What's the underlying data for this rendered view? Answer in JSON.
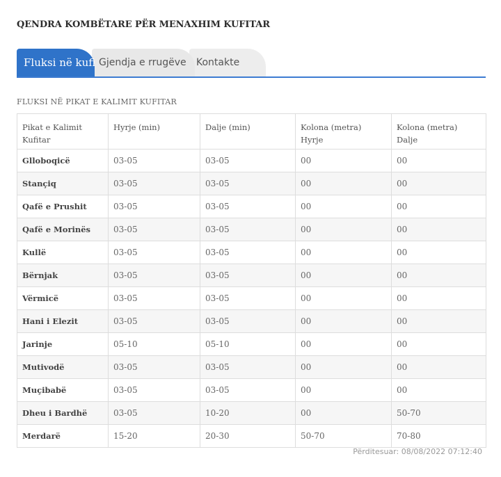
{
  "site": {
    "title": "QENDRA KOMBËTARE PËR MENAXHIM KUFITAR"
  },
  "tabs": [
    {
      "label": "Fluksi në kufi",
      "active": true
    },
    {
      "label": "Gjendja e rrugëve",
      "active": false
    },
    {
      "label": "Kontakte",
      "active": false
    }
  ],
  "section": {
    "title": "FLUKSI NË PIKAT E KALIMIT KUFITAR"
  },
  "table": {
    "headers": [
      "Pikat e Kalimit\nKufitar",
      "Hyrje (min)",
      "Dalje (min)",
      "Kolona (metra)\nHyrje",
      "Kolona (metra)\nDalje"
    ],
    "rows": [
      [
        "Glloboqicë",
        "03-05",
        "03-05",
        "00",
        "00"
      ],
      [
        "Stançiq",
        "03-05",
        "03-05",
        "00",
        "00"
      ],
      [
        "Qafë e Prushit",
        "03-05",
        "03-05",
        "00",
        "00"
      ],
      [
        "Qafë e Morinës",
        "03-05",
        "03-05",
        "00",
        "00"
      ],
      [
        "Kullë",
        "03-05",
        "03-05",
        "00",
        "00"
      ],
      [
        "Bërnjak",
        "03-05",
        "03-05",
        "00",
        "00"
      ],
      [
        "Vërmicë",
        "03-05",
        "03-05",
        "00",
        "00"
      ],
      [
        "Hani i Elezit",
        "03-05",
        "03-05",
        "00",
        "00"
      ],
      [
        "Jarinje",
        "05-10",
        "05-10",
        "00",
        "00"
      ],
      [
        "Mutivodë",
        "03-05",
        "03-05",
        "00",
        "00"
      ],
      [
        "Muçibabë",
        "03-05",
        "03-05",
        "00",
        "00"
      ],
      [
        "Dheu i Bardhë",
        "03-05",
        "10-20",
        "00",
        "50-70"
      ],
      [
        "Merdarë",
        "15-20",
        "20-30",
        "50-70",
        "70-80"
      ]
    ]
  },
  "footer": {
    "updated": "Përditesuar: 08/08/2022 07:12:40"
  },
  "colors": {
    "accent": "#2f73c9",
    "tab_inactive": "#e8e8e8",
    "border": "#dddddd"
  }
}
